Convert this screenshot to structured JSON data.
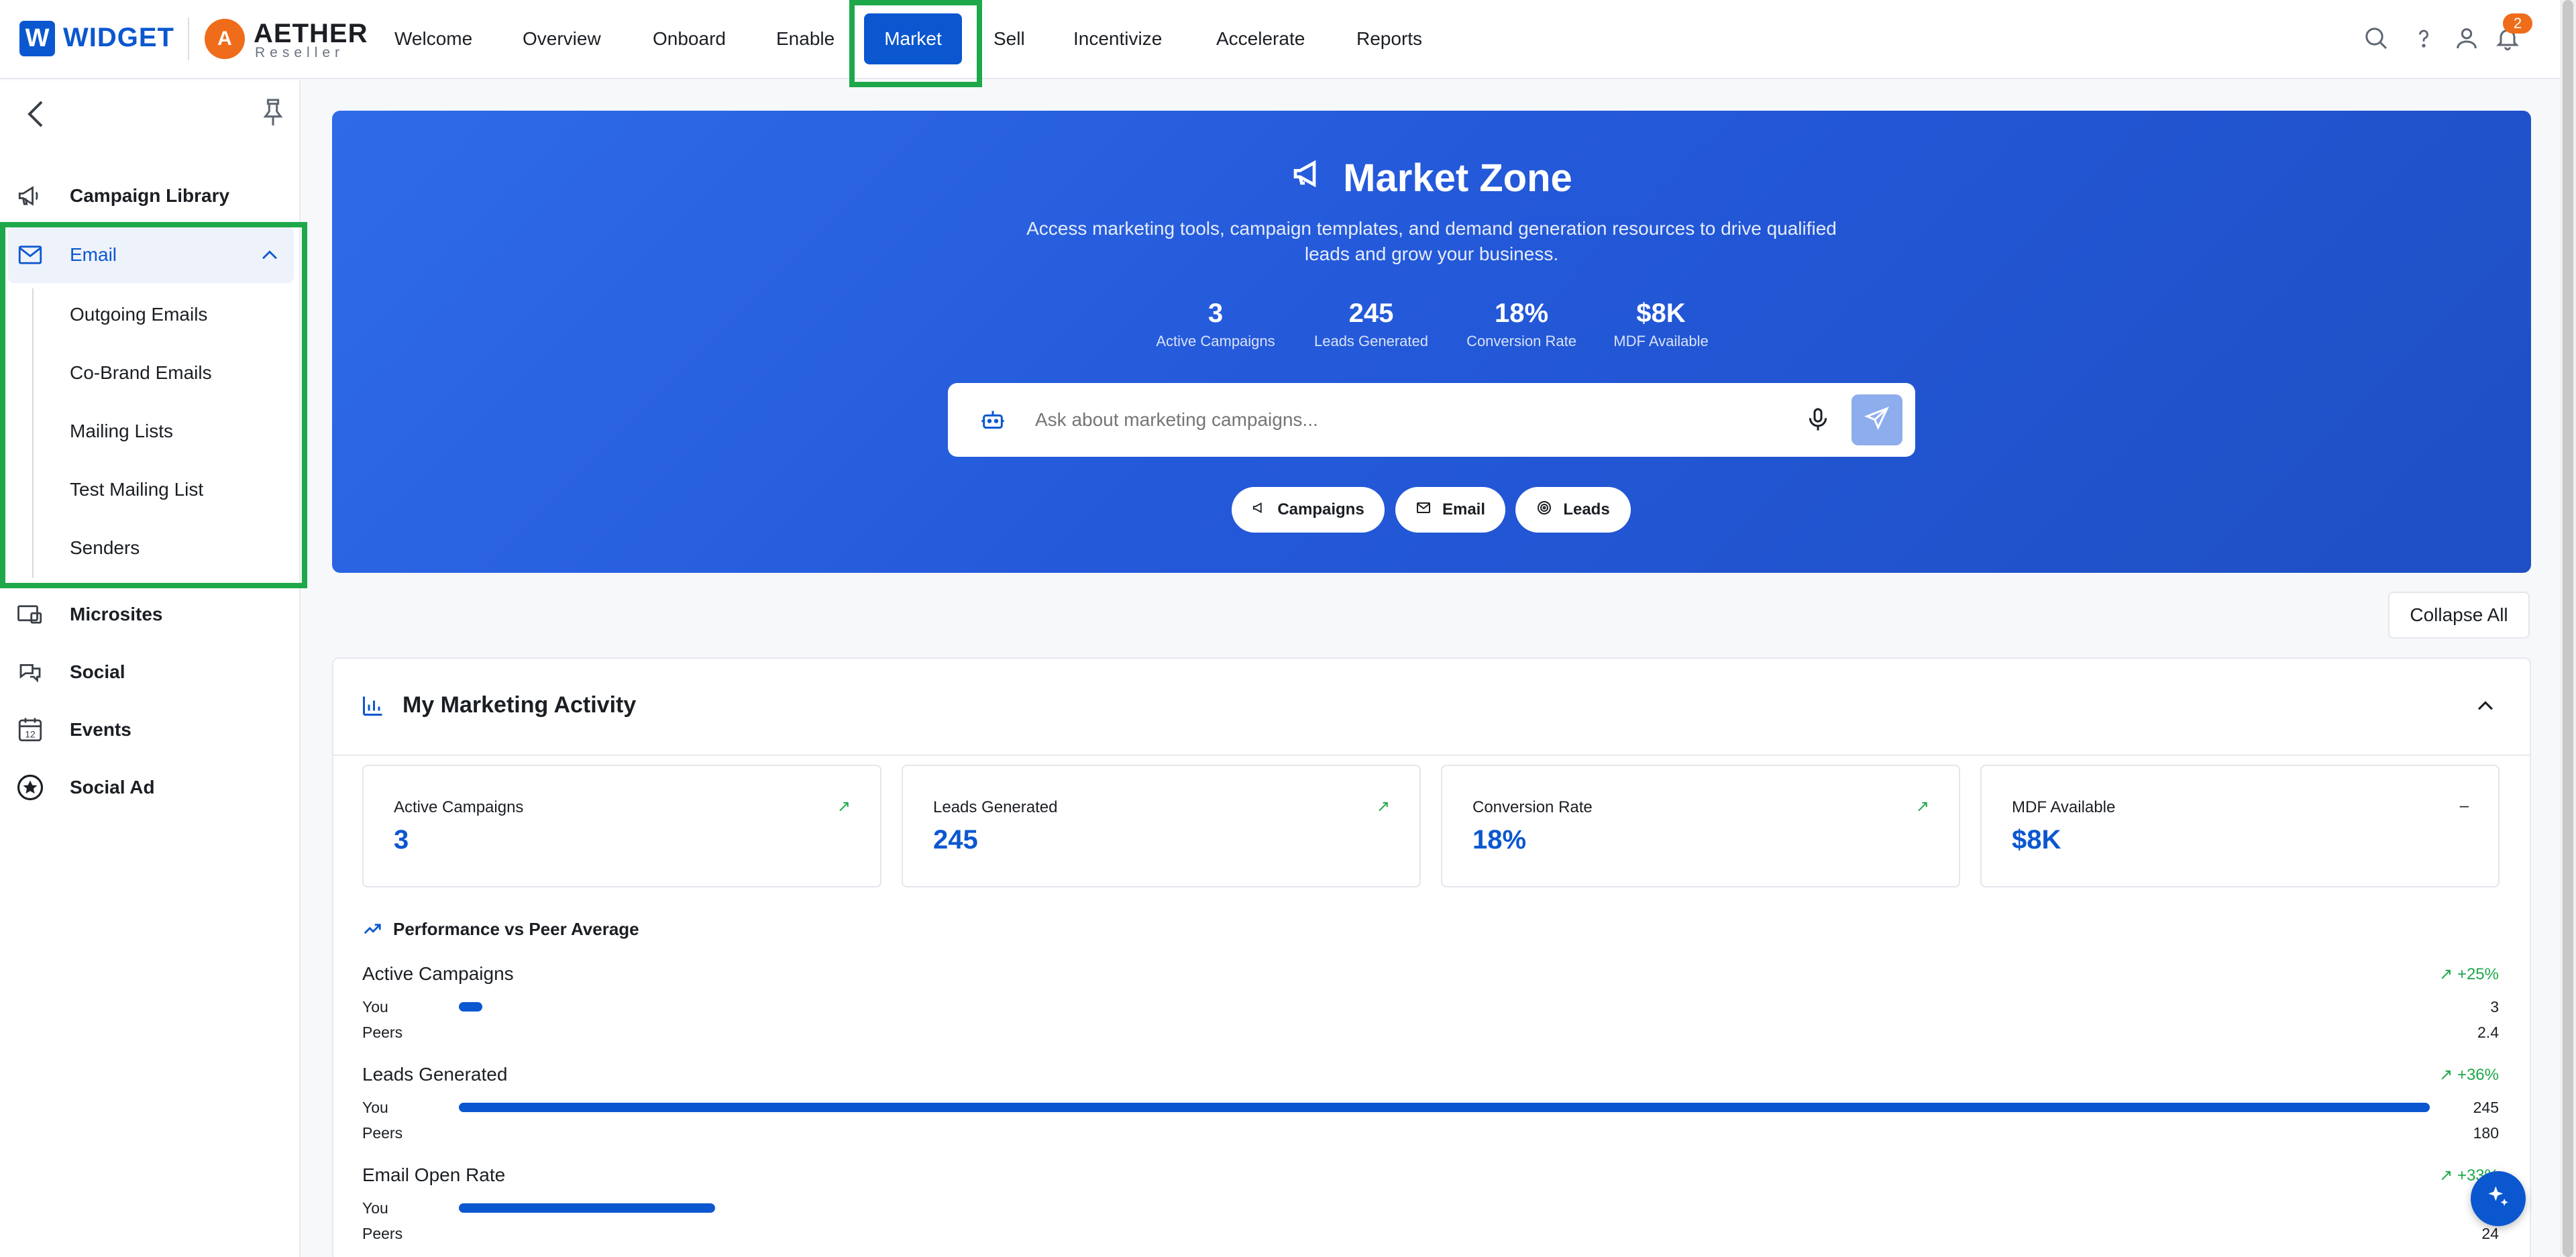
{
  "brand": {
    "w": "W",
    "widget": "WIDGET",
    "aether_mark": "A",
    "aether": "AETHER",
    "reseller": "Reseller"
  },
  "nav": {
    "items": [
      "Welcome",
      "Overview",
      "Onboard",
      "Enable",
      "Market",
      "Sell",
      "Incentivize",
      "Accelerate",
      "Reports"
    ],
    "active": "Market",
    "notifications": "2"
  },
  "sidebar": {
    "items": {
      "campaign_library": "Campaign Library",
      "email": "Email",
      "microsites": "Microsites",
      "social": "Social",
      "events": "Events",
      "social_ad": "Social Ad"
    },
    "email_sub": [
      "Outgoing Emails",
      "Co-Brand Emails",
      "Mailing Lists",
      "Test Mailing List",
      "Senders"
    ],
    "events_day": "12"
  },
  "hero": {
    "title": "Market Zone",
    "desc": "Access marketing tools, campaign templates, and demand generation resources to drive qualified leads and grow your business.",
    "stats": [
      {
        "value": "3",
        "label": "Active Campaigns"
      },
      {
        "value": "245",
        "label": "Leads Generated"
      },
      {
        "value": "18%",
        "label": "Conversion Rate"
      },
      {
        "value": "$8K",
        "label": "MDF Available"
      }
    ],
    "search_placeholder": "Ask about marketing campaigns...",
    "chips": [
      "Campaigns",
      "Email",
      "Leads"
    ]
  },
  "collapse_all": "Collapse All",
  "activity": {
    "title": "My Marketing Activity",
    "kpis": [
      {
        "label": "Active Campaigns",
        "value": "3",
        "trend": "↗"
      },
      {
        "label": "Leads Generated",
        "value": "245",
        "trend": "↗"
      },
      {
        "label": "Conversion Rate",
        "value": "18%",
        "trend": "↗"
      },
      {
        "label": "MDF Available",
        "value": "$8K",
        "trend": "–"
      }
    ],
    "perf_title": "Performance vs Peer Average",
    "you_label": "You",
    "peers_label": "Peers",
    "metrics": [
      {
        "name": "Active Campaigns",
        "delta": "+25%",
        "you": "3",
        "peers": "2.4",
        "you_fill": 0.012
      },
      {
        "name": "Leads Generated",
        "delta": "+36%",
        "you": "245",
        "peers": "180",
        "you_fill": 1.0
      },
      {
        "name": "Email Open Rate",
        "delta": "+33%",
        "you": "",
        "peers": "24",
        "you_fill": 0.13
      }
    ]
  },
  "colors": {
    "primary": "#0b57d0",
    "highlight": "#1ea84a",
    "accent_orange": "#ef6c1a",
    "trend_green": "#1ea84a"
  }
}
